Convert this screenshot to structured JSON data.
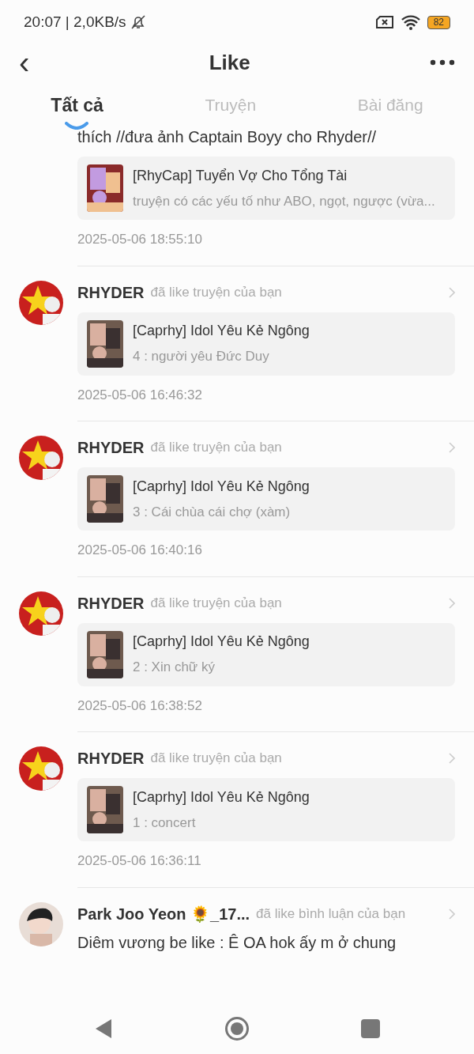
{
  "status_bar": {
    "time": "20:07 | 2,0KB/s",
    "battery": "82"
  },
  "header": {
    "back": "‹",
    "title": "Like"
  },
  "tabs": [
    {
      "label": "Tất cả",
      "selected": true
    },
    {
      "label": "Truyện",
      "selected": false
    },
    {
      "label": "Bài đăng",
      "selected": false
    }
  ],
  "items": [
    {
      "comment": "thích //đưa ảnh Captain Boyy cho Rhyder//",
      "card": {
        "title": "[RhyCap] Tuyển Vợ Cho Tổng Tài",
        "subtitle": "truyện có các yếu tố như ABO, ngọt, ngược (vừa..."
      },
      "time": "2025-05-06 18:55:10"
    },
    {
      "user": "RHYDER",
      "action": "đã like truyện của bạn",
      "card": {
        "title": "[Caprhy] Idol Yêu Kẻ Ngông",
        "subtitle": "4 : người yêu Đức Duy"
      },
      "time": "2025-05-06 16:46:32"
    },
    {
      "user": "RHYDER",
      "action": "đã like truyện của bạn",
      "card": {
        "title": "[Caprhy] Idol Yêu Kẻ Ngông",
        "subtitle": "3 : Cái chùa cái chợ (xàm)"
      },
      "time": "2025-05-06 16:40:16"
    },
    {
      "user": "RHYDER",
      "action": "đã like truyện của bạn",
      "card": {
        "title": "[Caprhy] Idol Yêu Kẻ Ngông",
        "subtitle": "2 : Xin chữ ký"
      },
      "time": "2025-05-06 16:38:52"
    },
    {
      "user": "RHYDER",
      "action": "đã like truyện của bạn",
      "card": {
        "title": "[Caprhy] Idol Yêu Kẻ Ngông",
        "subtitle": "1 : concert"
      },
      "time": "2025-05-06 16:36:11"
    },
    {
      "user": "Park Joo Yeon 🌻_17...",
      "action": "đã like bình luận của bạn",
      "comment": "Diêm vương be like : Ê OA hok ấy m ở chung"
    }
  ]
}
